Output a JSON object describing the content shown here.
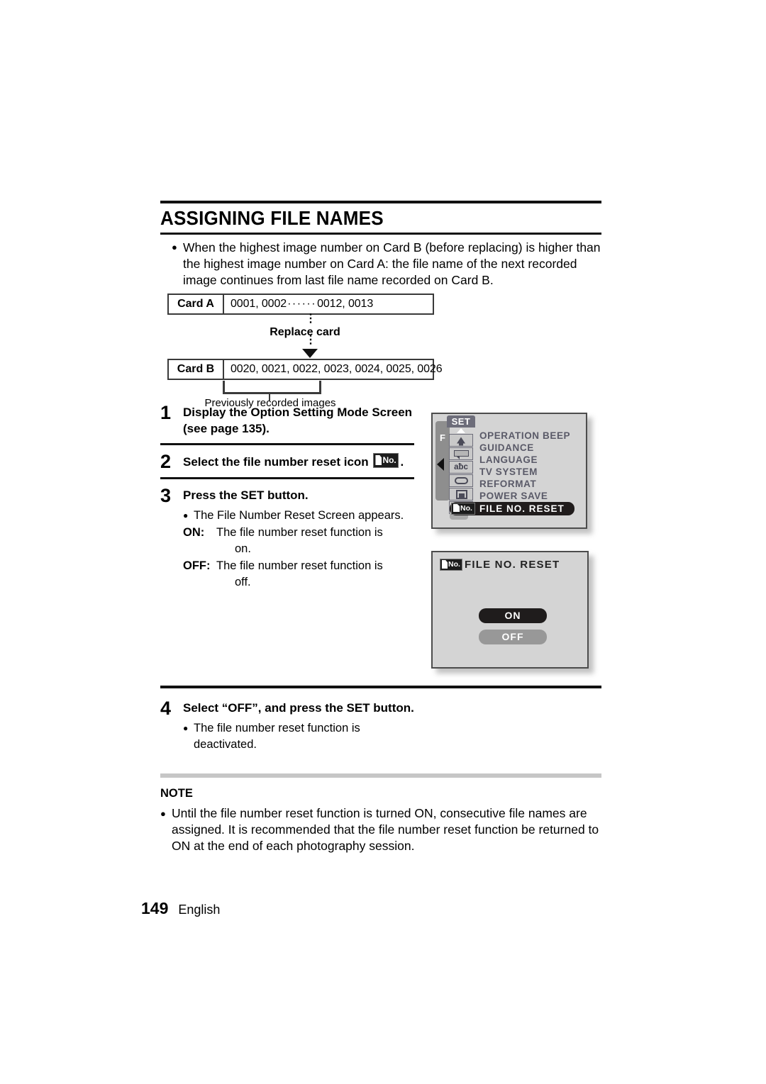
{
  "document": {
    "title": "ASSIGNING FILE NAMES",
    "intro_bullet": "When the highest image number on Card B (before replacing) is higher than the highest image number on Card A: the file name of the next recorded image continues from last file name recorded on Card B."
  },
  "card_diagram": {
    "card_a_label": "Card A",
    "card_a_values_start": "0001, 0002",
    "card_a_dots": "······",
    "card_a_values_end": "0012, 0013",
    "replace_label": "Replace card",
    "dots_glyph": "⋮",
    "card_b_label": "Card B",
    "card_b_values": "0020, 0021, 0022, 0023, 0024, 0025, 0026",
    "brace_caption": "Previously recorded images"
  },
  "steps": [
    {
      "number": "1",
      "title": "Display the Option Setting Mode Screen (see page 135)."
    },
    {
      "number": "2",
      "title_before_icon": "Select the file number reset icon",
      "icon_name": "file-number-reset-icon",
      "title_after_icon": "."
    },
    {
      "number": "3",
      "title": "Press the SET button.",
      "bullet": "The File Number Reset Screen appears.",
      "definitions": [
        {
          "term": "ON:",
          "text": "The file number reset function is",
          "hang": "on."
        },
        {
          "term": "OFF:",
          "text": "The file number reset function is",
          "hang": "off."
        }
      ]
    },
    {
      "number": "4",
      "title": "Select “OFF”, and press the SET button.",
      "bullet": "The file number reset function is deactivated."
    }
  ],
  "lcd_menu_screen": {
    "tab_letter": "F",
    "set_label": "SET",
    "icons": [
      {
        "name": "operation-beep-icon",
        "label": ""
      },
      {
        "name": "guidance-icon",
        "label": ""
      },
      {
        "name": "language-icon",
        "label": "aƀc"
      },
      {
        "name": "tv-system-icon",
        "label": ""
      },
      {
        "name": "reformat-icon",
        "label": ""
      },
      {
        "name": "power-save-icon",
        "label": "PS"
      }
    ],
    "menu_items": [
      "OPERATION BEEP",
      "GUIDANCE",
      "LANGUAGE",
      "TV SYSTEM",
      "REFORMAT",
      "POWER SAVE"
    ],
    "highlighted_item": "FILE NO. RESET",
    "highlight_icon_text": "No."
  },
  "lcd_reset_screen": {
    "header_icon_text": "No.",
    "header_title": "FILE NO. RESET",
    "options": [
      {
        "label": "ON",
        "state": "selected"
      },
      {
        "label": "OFF",
        "state": "unselected"
      }
    ]
  },
  "note": {
    "heading": "NOTE",
    "body": "Until the file number reset function is turned ON, consecutive file names are assigned. It is recommended that the file number reset function be returned to ON at the end of each photography session."
  },
  "footer": {
    "page_number": "149",
    "language": "English"
  },
  "colors": {
    "rule": "#111111",
    "gray_rule": "#c6c6c6",
    "lcd_background": "#d4d4d4",
    "lcd_border": "#4c4c4c",
    "menu_text": "#5a5a68",
    "highlight": "#201c1c",
    "option_off": "#989898"
  }
}
